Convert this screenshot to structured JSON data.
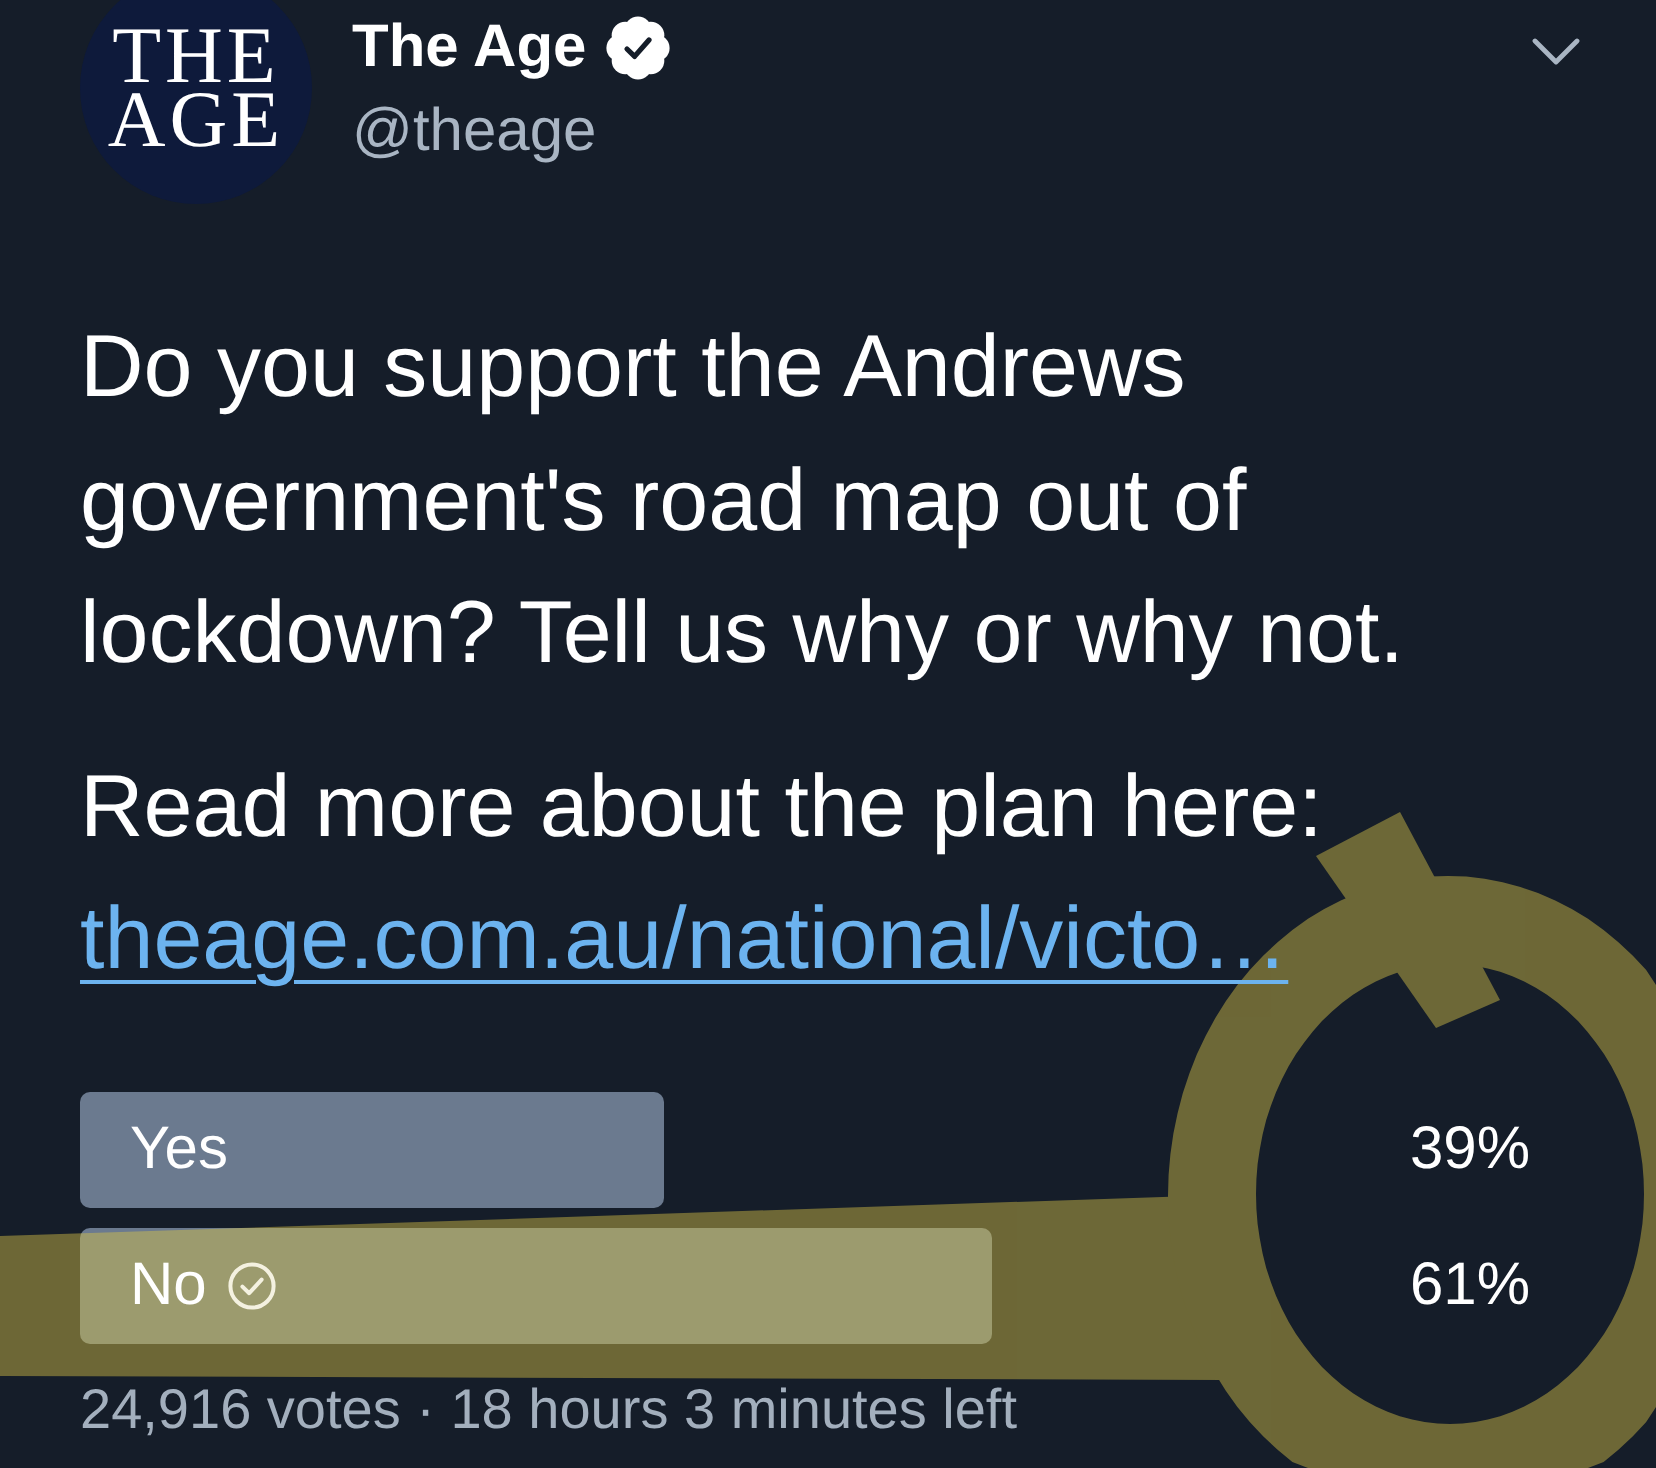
{
  "author": {
    "avatar_text": [
      "THE",
      "AGE"
    ],
    "name": "The Age",
    "verified": true,
    "handle": "@theage"
  },
  "tweet": {
    "text": "Do you support the Andrews government's road map out of lockdown? Tell us why or why not.",
    "more_text": "Read more about the plan here:",
    "link": "theage.com.au/national/victo…"
  },
  "poll": {
    "options": [
      {
        "label": "Yes",
        "percent": "39%",
        "level": 0.39,
        "voted": false
      },
      {
        "label": "No",
        "percent": "61%",
        "level": 0.61,
        "voted": true
      }
    ],
    "summary": "24,916 votes · 18 hours 3 minutes left"
  }
}
